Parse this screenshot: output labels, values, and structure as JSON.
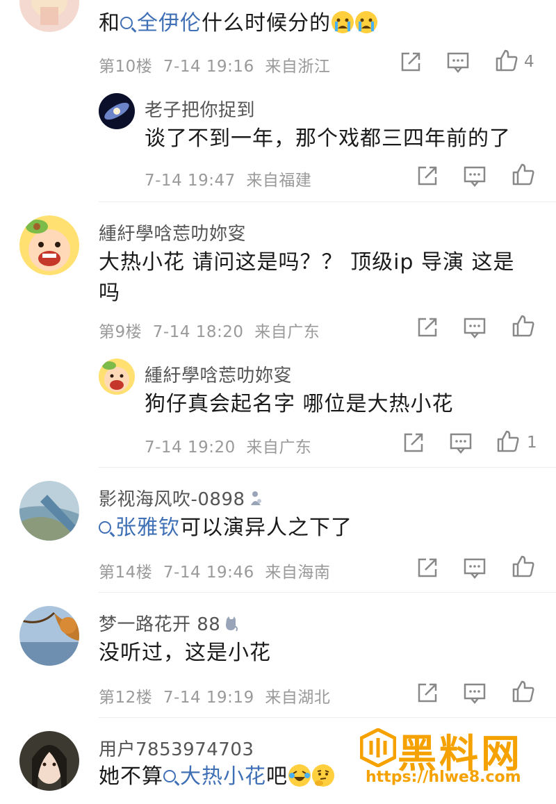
{
  "colors": {
    "topic": "#3f6fb5",
    "meta": "#9a9a9a",
    "watermark": "#f5a200"
  },
  "comments": [
    {
      "text_before": "和",
      "topic": "全伊伦",
      "text_after": "什么时候分的",
      "emojis": [
        "crying-face",
        "crying-face"
      ],
      "floor": "第10楼",
      "time": "7-14 19:16",
      "location": "来自浙江",
      "like_count": "4"
    },
    {
      "username": "老子把你捉到",
      "text": "谈了不到一年，那个戏都三四年前的了",
      "time": "7-14 19:47",
      "location": "来自福建",
      "like_count": ""
    },
    {
      "username": "緟紆學唅莣叻妳叜",
      "text_line1": "大热小花  请问这是吗？？  顶级ip  导演  这是",
      "text_line2": "吗",
      "floor": "第9楼",
      "time": "7-14 18:20",
      "location": "来自广东",
      "like_count": ""
    },
    {
      "username": "緟紆學唅莣叻妳叜",
      "text": "狗仔真会起名字  哪位是大热小花",
      "time": "7-14 19:20",
      "location": "来自广东",
      "like_count": "1"
    },
    {
      "username": "影视海风吹-0898",
      "topic": "张雅钦",
      "text_after": "可以演异人之下了",
      "floor": "第14楼",
      "time": "7-14 19:46",
      "location": "来自海南",
      "like_count": ""
    },
    {
      "username": "梦一路花开 88",
      "text": "没听过，这是小花",
      "floor": "第12楼",
      "time": "7-14 19:19",
      "location": "来自湖北",
      "like_count": ""
    },
    {
      "username": "用户7853974703",
      "text_before": "她不算",
      "topic": "大热小花",
      "text_after": "吧",
      "emojis": [
        "laughing-crying-face",
        "thinking-face"
      ]
    }
  ],
  "watermark": {
    "title": "黑料网",
    "url": "https://hlwe8.com"
  }
}
